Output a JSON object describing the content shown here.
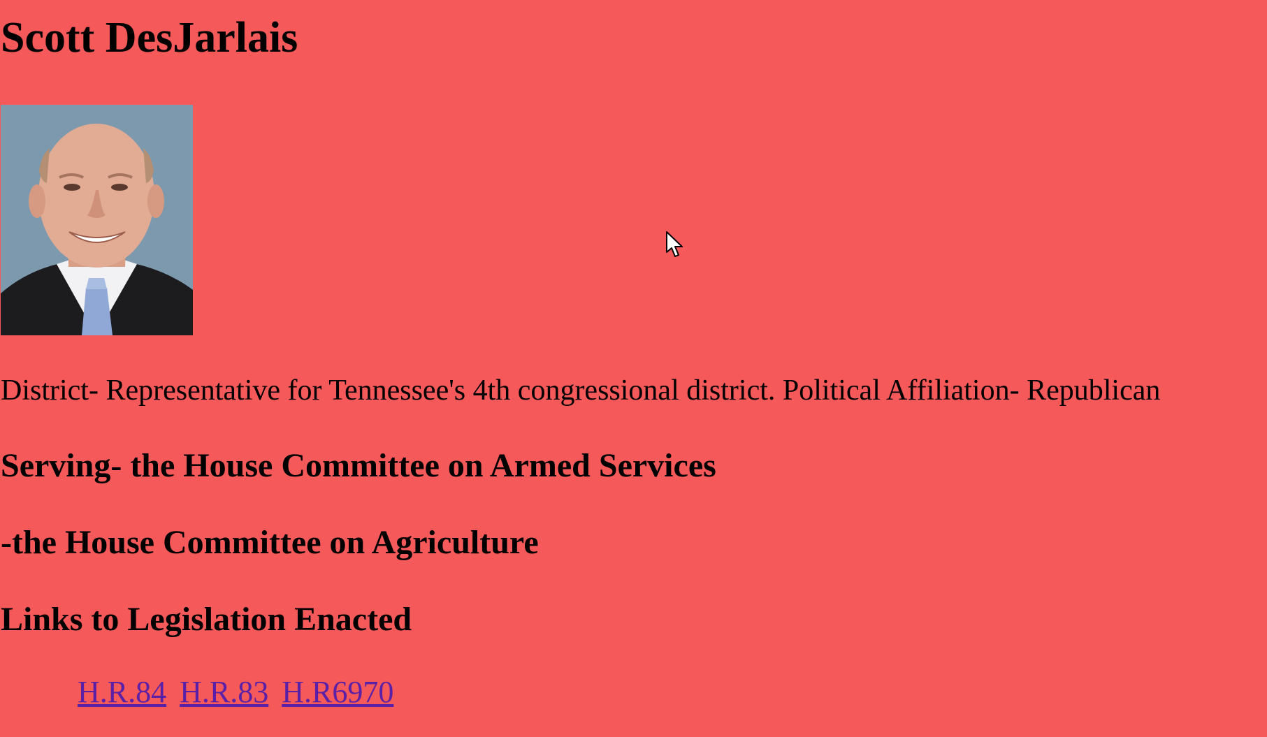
{
  "page": {
    "background_color": "#f55959",
    "title": "Scott DesJarlais",
    "summary": "District- Representative for Tennessee's 4th congressional district. Political Affiliation- Republican",
    "committee_heading_1": "Serving- the House Committee on Armed Services",
    "committee_heading_2": "-the House Committee on Agriculture",
    "links_heading": "Links to Legislation Enacted",
    "links": [
      {
        "label": "H.R.84"
      },
      {
        "label": "H.R.83"
      },
      {
        "label": "H.R6970"
      }
    ],
    "link_color": "#5b20a8"
  }
}
